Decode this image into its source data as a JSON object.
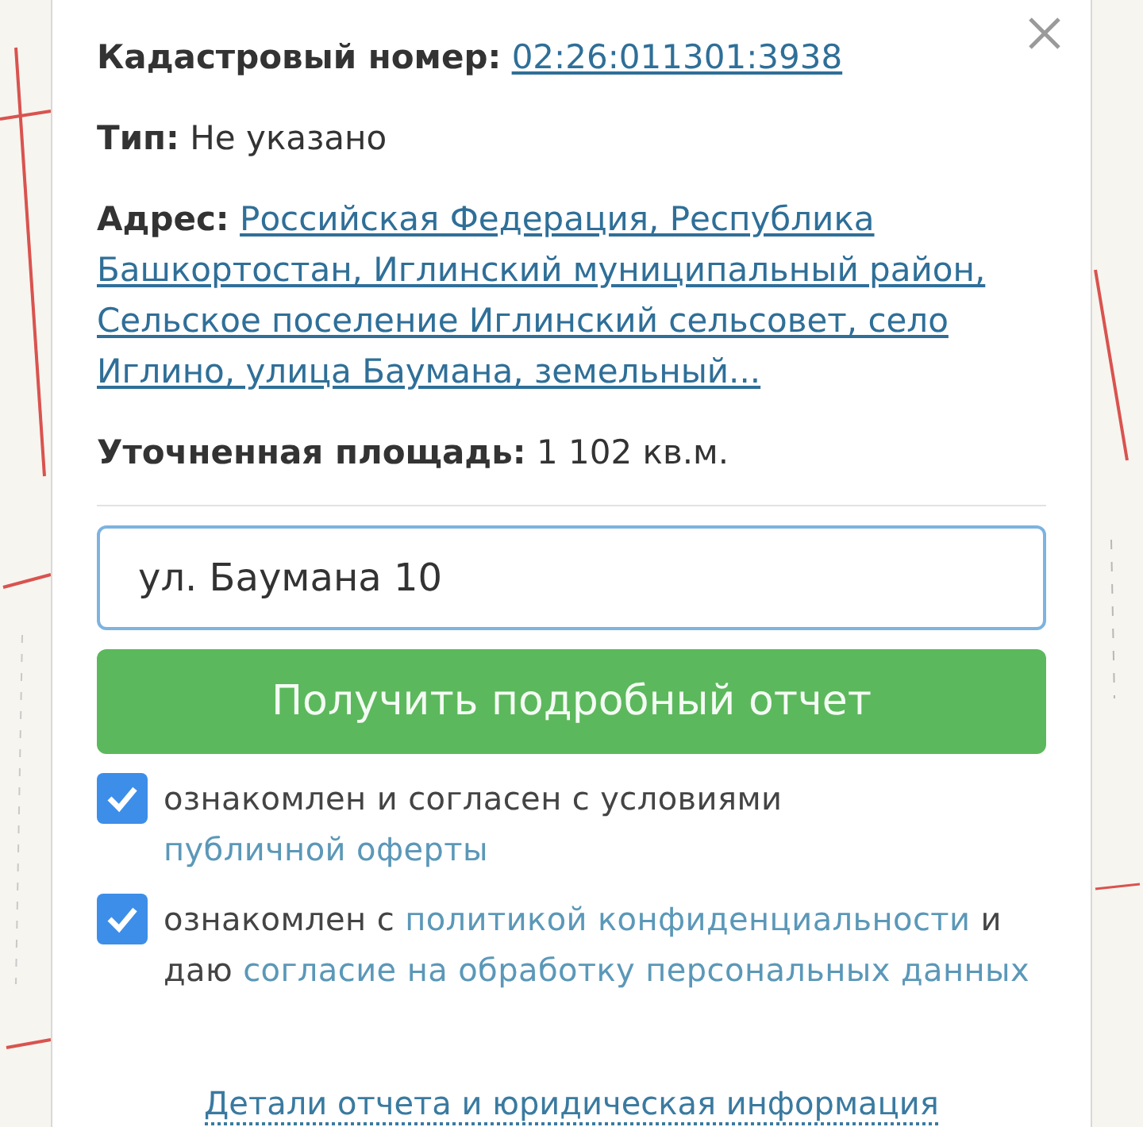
{
  "fields": [
    {
      "label": "Кадастровый номер:",
      "value": "02:26:011301:3938",
      "kind": "link"
    },
    {
      "label": "Тип:",
      "value": "Не указано",
      "kind": "text"
    },
    {
      "label": "Адрес:",
      "value": "Российская Федерация, Республика Башкортостан, Иглинский муниципальный район, Сельское поселение Иглинский сельсовет, село Иглино, улица Баумана, земельный...",
      "kind": "link"
    },
    {
      "label": "Уточненная площадь:",
      "value": "1 102 кв.м.",
      "kind": "text"
    }
  ],
  "address_input": {
    "value": "ул. Баумана 10"
  },
  "submit_button": "Получить подробный отчет",
  "agreements": [
    {
      "checked": true,
      "parts": [
        {
          "kind": "text",
          "text": "ознакомлен и согласен с условиями"
        },
        {
          "kind": "link",
          "text": "публичной оферты"
        }
      ]
    },
    {
      "checked": true,
      "parts": [
        {
          "kind": "text",
          "text": "ознакомлен с"
        },
        {
          "kind": "link",
          "text": "политикой конфиденциальности"
        },
        {
          "kind": "text",
          "text": "и даю"
        },
        {
          "kind": "link",
          "text": "согласие на обработку персональных данных"
        }
      ]
    }
  ],
  "footer_link": "Детали отчета и юридическая информация"
}
